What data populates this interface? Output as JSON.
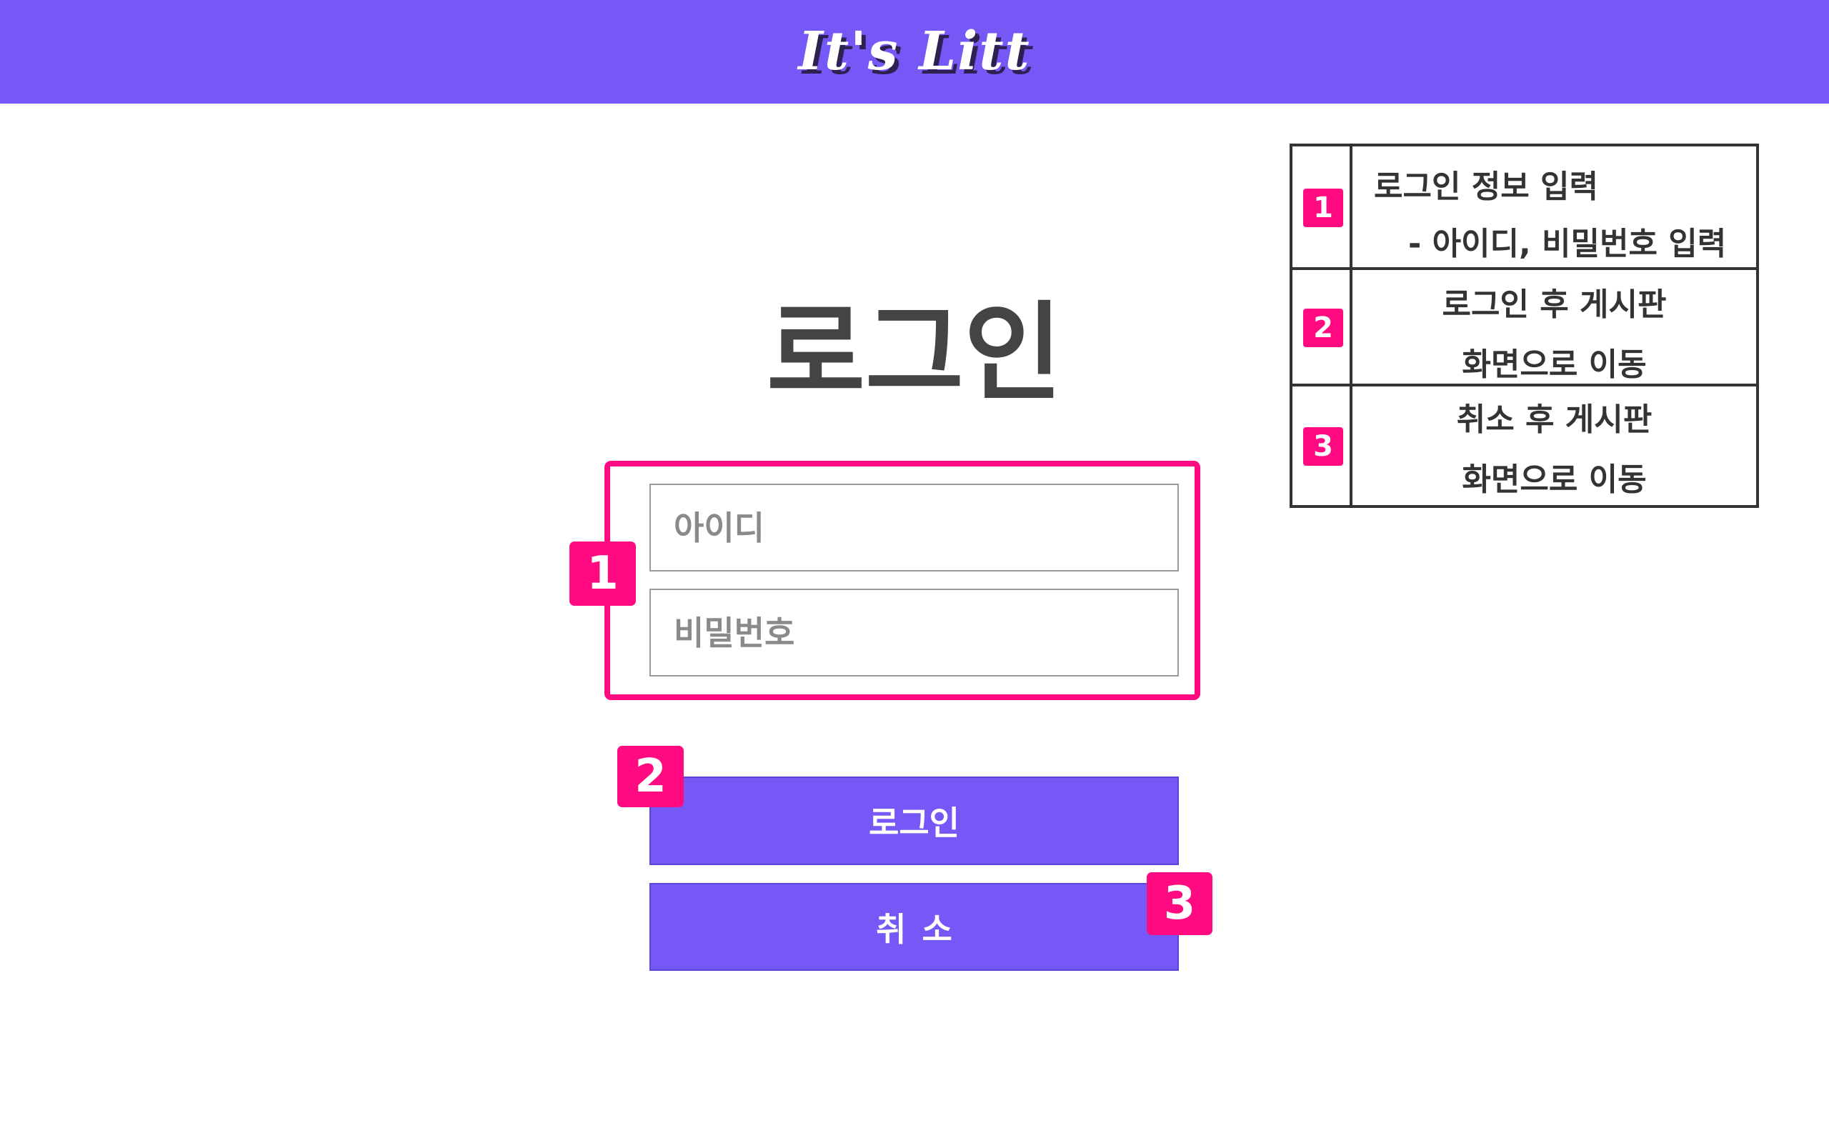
{
  "header": {
    "brand": "It's Litt",
    "background": "#7558f5"
  },
  "main": {
    "title": "로그인",
    "id_placeholder": "아이디",
    "password_placeholder": "비밀번호",
    "login_button": "로그인",
    "cancel_button": "취소"
  },
  "annotations": {
    "accent": "#ff0a80",
    "markers": [
      "1",
      "2",
      "3"
    ]
  },
  "legend": {
    "rows": [
      {
        "num": "1",
        "line1": "로그인 정보 입력",
        "line2": "- 아이디, 비밀번호 입력"
      },
      {
        "num": "2",
        "line1": "로그인 후 게시판",
        "line2": "화면으로 이동"
      },
      {
        "num": "3",
        "line1": "취소 후 게시판",
        "line2": "화면으로 이동"
      }
    ]
  }
}
